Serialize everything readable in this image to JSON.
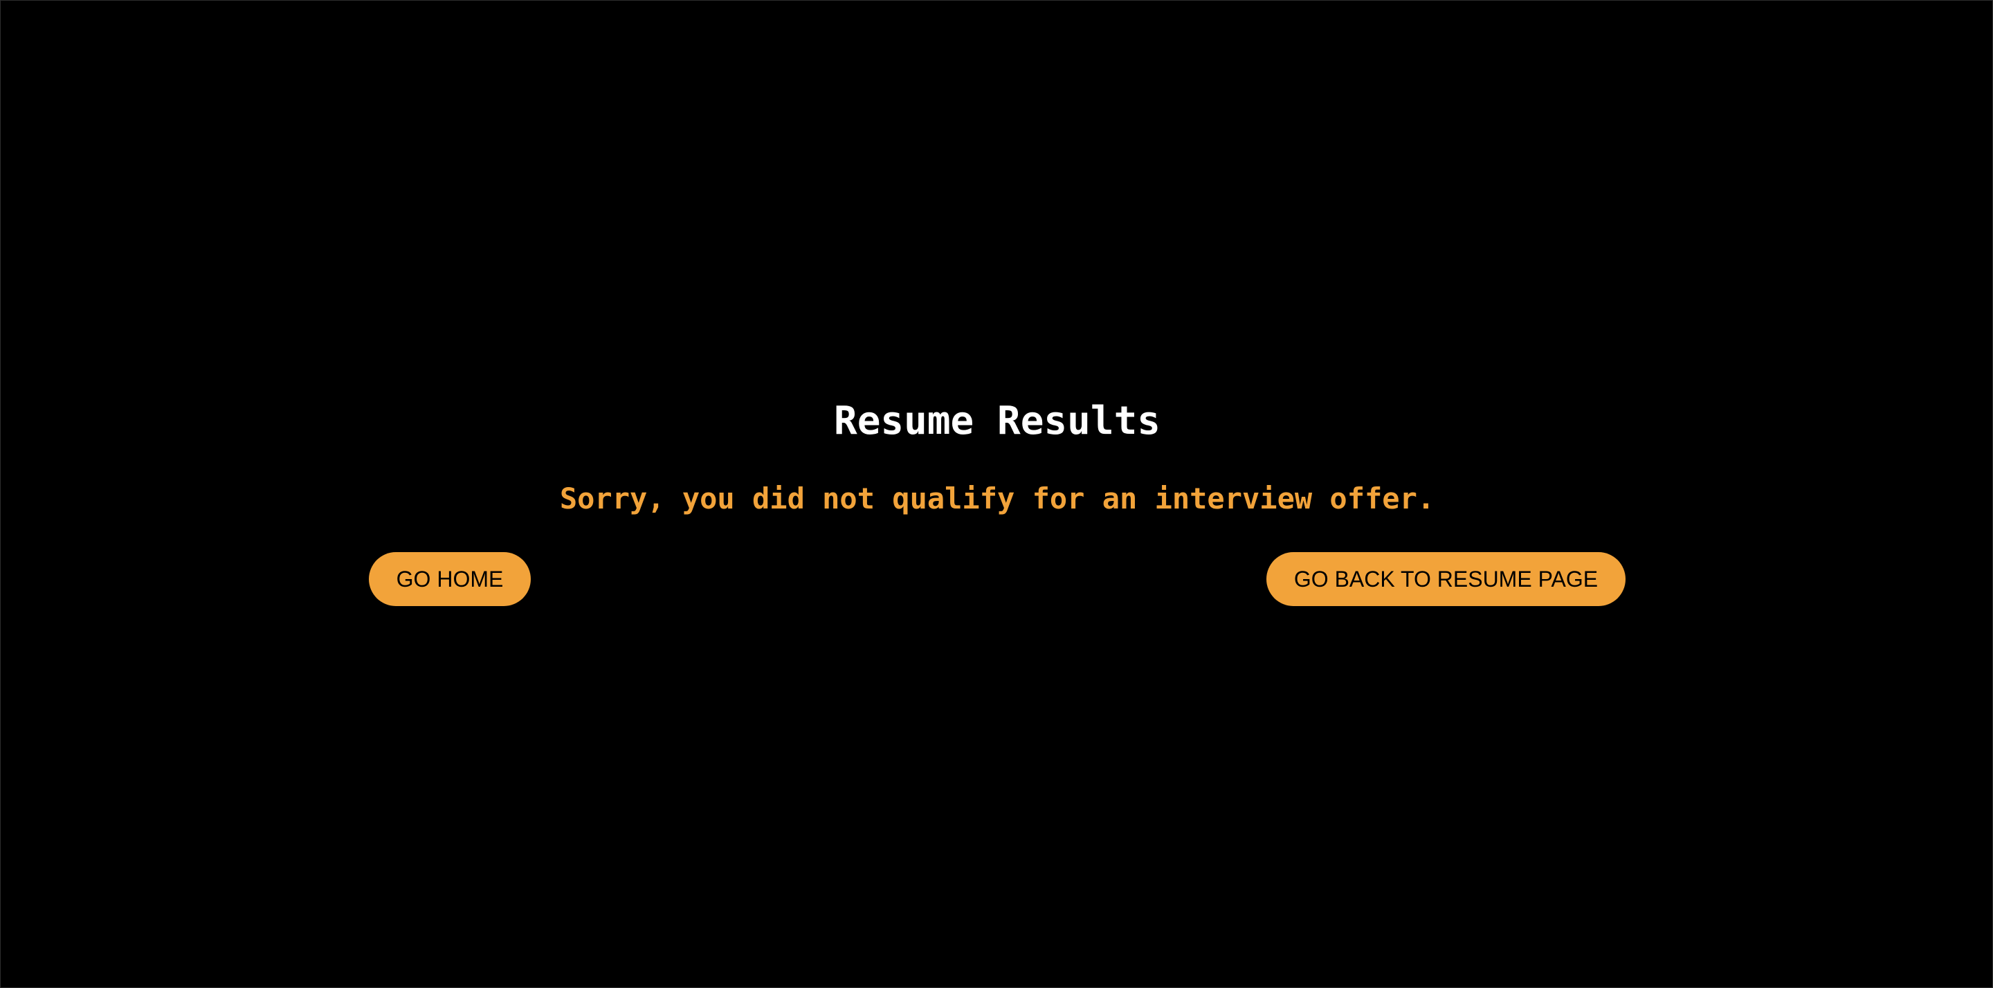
{
  "page": {
    "title": "Resume Results",
    "message": "Sorry, you did not qualify for an interview offer."
  },
  "actions": {
    "home_label": "GO HOME",
    "resume_label": "GO BACK TO RESUME PAGE"
  },
  "colors": {
    "background": "#000000",
    "accent": "#f2a33a",
    "title_text": "#ffffff",
    "button_text": "#000000"
  }
}
